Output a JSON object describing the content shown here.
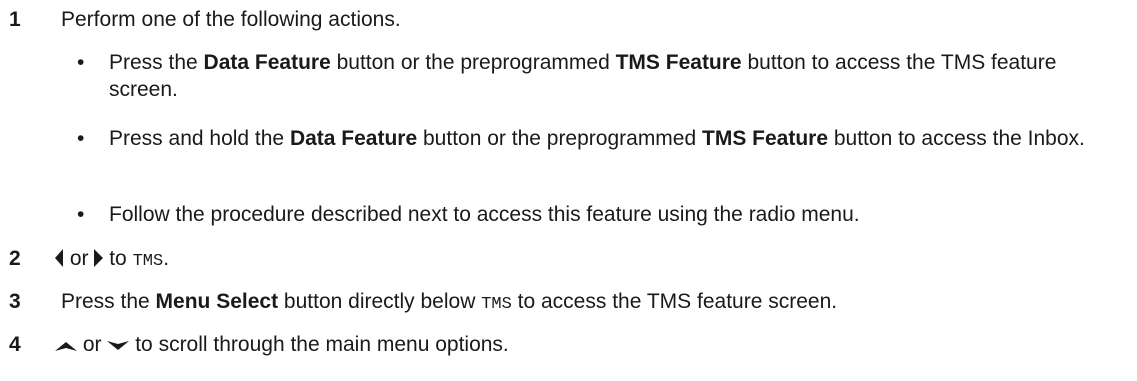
{
  "steps": [
    {
      "num": "1",
      "text": "Perform one of the following actions."
    },
    {
      "num": "2",
      "or": "or",
      "to": "to",
      "target": "TMS",
      "end": ".",
      "left_icon": "left-arrow-icon",
      "right_icon": "right-arrow-icon"
    },
    {
      "num": "3",
      "pre": "Press the ",
      "button": "Menu Select",
      "mid": " button directly below ",
      "target": "TMS",
      "post": " to access the TMS feature screen."
    },
    {
      "num": "4",
      "or": "or",
      "post": "to scroll through the main menu options.",
      "up_icon": "up-arrow-icon",
      "down_icon": "down-arrow-icon"
    }
  ],
  "bullets": [
    {
      "dot": "•",
      "pre": "Press the ",
      "b1": "Data Feature",
      "mid": " button or the preprogrammed ",
      "b2": "TMS Feature",
      "post": " button to access the TMS feature screen."
    },
    {
      "dot": "•",
      "pre": "Press and hold the ",
      "b1": "Data Feature",
      "mid": " button or the preprogrammed ",
      "b2": "TMS Feature",
      "post": " button to access the Inbox."
    },
    {
      "dot": "•",
      "text": "Follow the procedure described next to access this feature using the radio menu."
    }
  ]
}
